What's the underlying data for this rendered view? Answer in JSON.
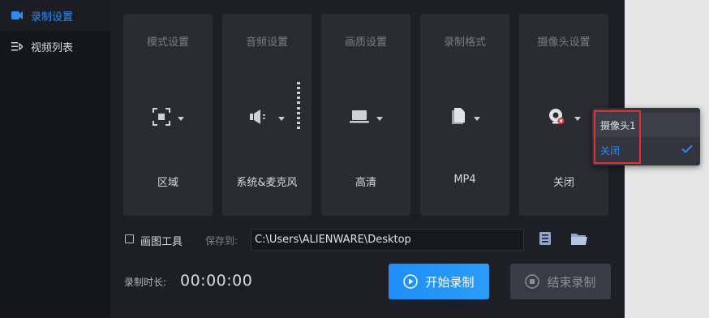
{
  "sidebar": {
    "items": [
      {
        "label": "录制设置",
        "icon": "video-camera-icon",
        "active": true
      },
      {
        "label": "视频列表",
        "icon": "list-icon",
        "active": false
      }
    ]
  },
  "cards": [
    {
      "title": "模式设置",
      "value": "区域",
      "icon": "region-select-icon"
    },
    {
      "title": "音频设置",
      "value": "系统&麦克风",
      "icon": "speaker-icon"
    },
    {
      "title": "画质设置",
      "value": "高清",
      "icon": "laptop-icon"
    },
    {
      "title": "录制格式",
      "value": "MP4",
      "icon": "file-format-icon"
    },
    {
      "title": "摄像头设置",
      "value": "关闭",
      "icon": "webcam-off-icon"
    }
  ],
  "camera_dropdown": {
    "options": [
      "摄像头1",
      "关闭"
    ],
    "selected": "关闭"
  },
  "tools": {
    "drawing_tool_label": "画图工具",
    "drawing_tool_checked": false,
    "save_to_label": "保存到:",
    "save_path": "C:\\Users\\ALIENWARE\\Desktop"
  },
  "recording": {
    "duration_label": "录制时长:",
    "duration_value": "00:00:00",
    "start_label": "开始录制",
    "stop_label": "结束录制"
  },
  "colors": {
    "accent": "#2b8cf5",
    "highlight_box": "#e0352f"
  }
}
